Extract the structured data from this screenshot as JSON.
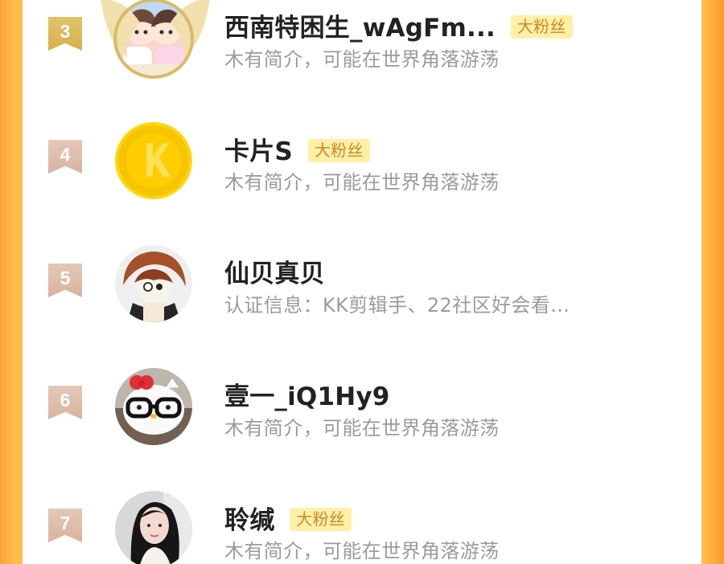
{
  "rows": [
    {
      "rank": "3",
      "name": "西南特困生_wAgFm...",
      "badge": "大粉丝",
      "desc": "木有简介，可能在世界角落游荡",
      "avatar": "chibi-couple-avatar",
      "frame": "gold-wing-frame"
    },
    {
      "rank": "4",
      "name": "卡片S",
      "badge": "大粉丝",
      "desc": "木有简介，可能在世界角落游荡",
      "avatar": "gold-coin-k-avatar"
    },
    {
      "rank": "5",
      "name": "仙贝真贝",
      "badge": "",
      "desc": "认证信息：KK剪辑手、22社区好会看...",
      "avatar": "red-hair-character-avatar"
    },
    {
      "rank": "6",
      "name": "壹一_iQ1Hy9",
      "badge": "",
      "desc": "木有简介，可能在世界角落游荡",
      "avatar": "hello-kitty-glasses-avatar"
    },
    {
      "rank": "7",
      "name": "聆缄",
      "badge": "大粉丝",
      "desc": "木有简介，可能在世界角落游荡",
      "avatar": "photo-girl-avatar"
    }
  ],
  "colors": {
    "background_orange": "#ffbe4a",
    "rank_gold": "#d8b04b",
    "rank_plain": "#d8b3a0",
    "badge_bg": "#fff0a8",
    "badge_text": "#c88924",
    "name_text": "#222222",
    "desc_text": "#9b9b9b"
  }
}
